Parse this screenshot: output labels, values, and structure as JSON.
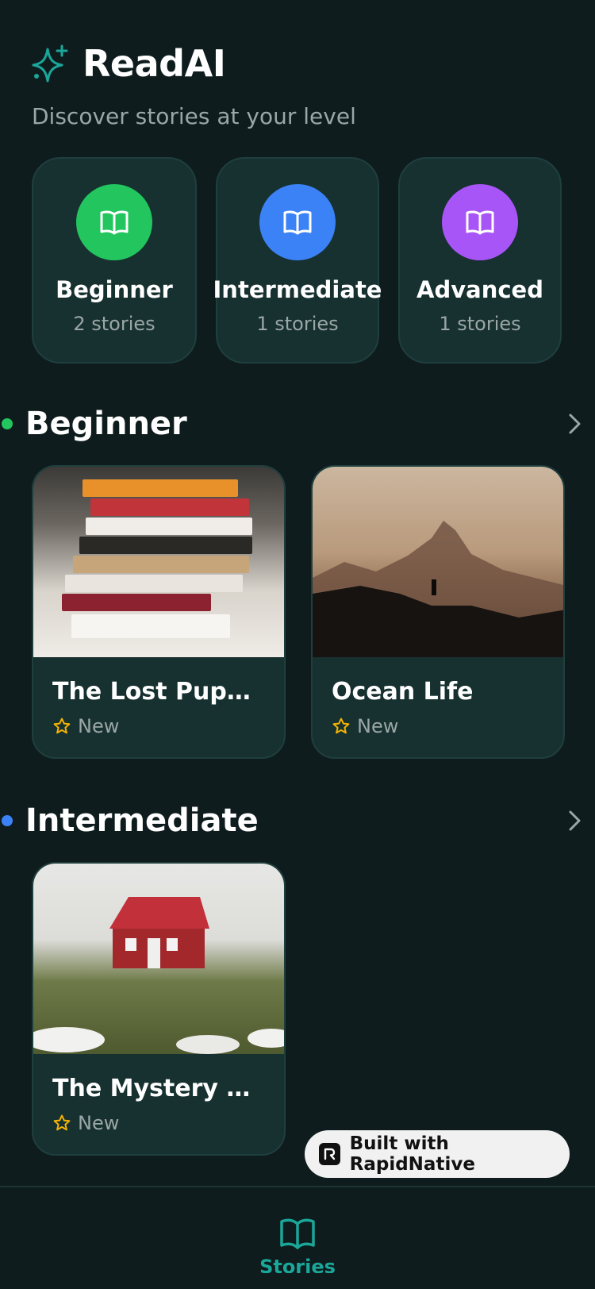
{
  "app": {
    "title": "ReadAI",
    "subtitle": "Discover stories at your level"
  },
  "levels": [
    {
      "name": "Beginner",
      "count": "2 stories",
      "color": "#22c55e"
    },
    {
      "name": "Intermediate",
      "count": "1 stories",
      "color": "#3b82f6"
    },
    {
      "name": "Advanced",
      "count": "1 stories",
      "color": "#a855f7"
    }
  ],
  "sections": [
    {
      "title": "Beginner",
      "dot_color": "#22c55e",
      "stories": [
        {
          "title": "The Lost Puppy",
          "tag": "New"
        },
        {
          "title": "Ocean Life",
          "tag": "New"
        }
      ]
    },
    {
      "title": "Intermediate",
      "dot_color": "#3b82f6",
      "stories": [
        {
          "title": "The Mystery of t...",
          "tag": "New"
        }
      ]
    }
  ],
  "badge": {
    "label": "Built with RapidNative"
  },
  "tabbar": {
    "stories_label": "Stories",
    "accent": "#1aa79a"
  },
  "icons": {
    "brand": "sparkle-icon",
    "level": "book-open-icon",
    "chevron": "chevron-right-icon",
    "tag": "star-icon"
  }
}
